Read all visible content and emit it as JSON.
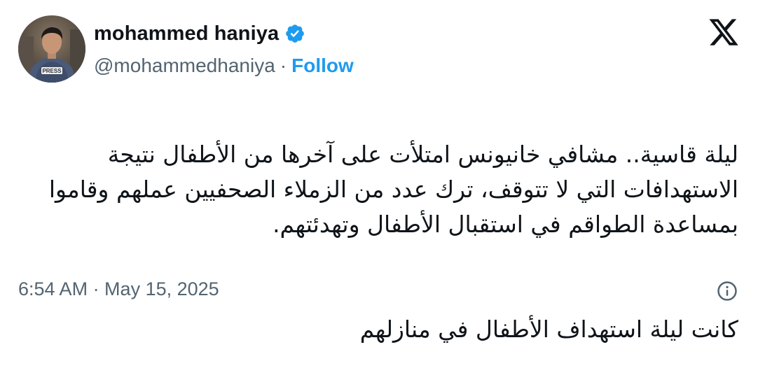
{
  "author": {
    "display_name": "mohammed haniya",
    "handle": "@mohammedhaniya",
    "separator": "·",
    "follow_label": "Follow",
    "verified": true,
    "avatar_badge_text": "PRESS"
  },
  "icons": {
    "verified": "verified-badge-icon",
    "platform": "x-logo-icon",
    "info": "info-icon"
  },
  "colors": {
    "accent": "#1d9bf0",
    "text_primary": "#0f1419",
    "text_secondary": "#536471"
  },
  "tweet": {
    "paragraph_1": "ليلة قاسية.. مشافي خانيونس امتلأت على آخرها من الأطفال نتيجة الاستهدافات التي لا تتوقف، ترك عدد من الزملاء الصحفيين عملهم وقاموا بمساعدة الطواقم في استقبال الأطفال وتهدئتهم.",
    "paragraph_2": "كانت ليلة استهداف الأطفال في منازلهم",
    "timestamp": "6:54 AM · May 15, 2025"
  }
}
